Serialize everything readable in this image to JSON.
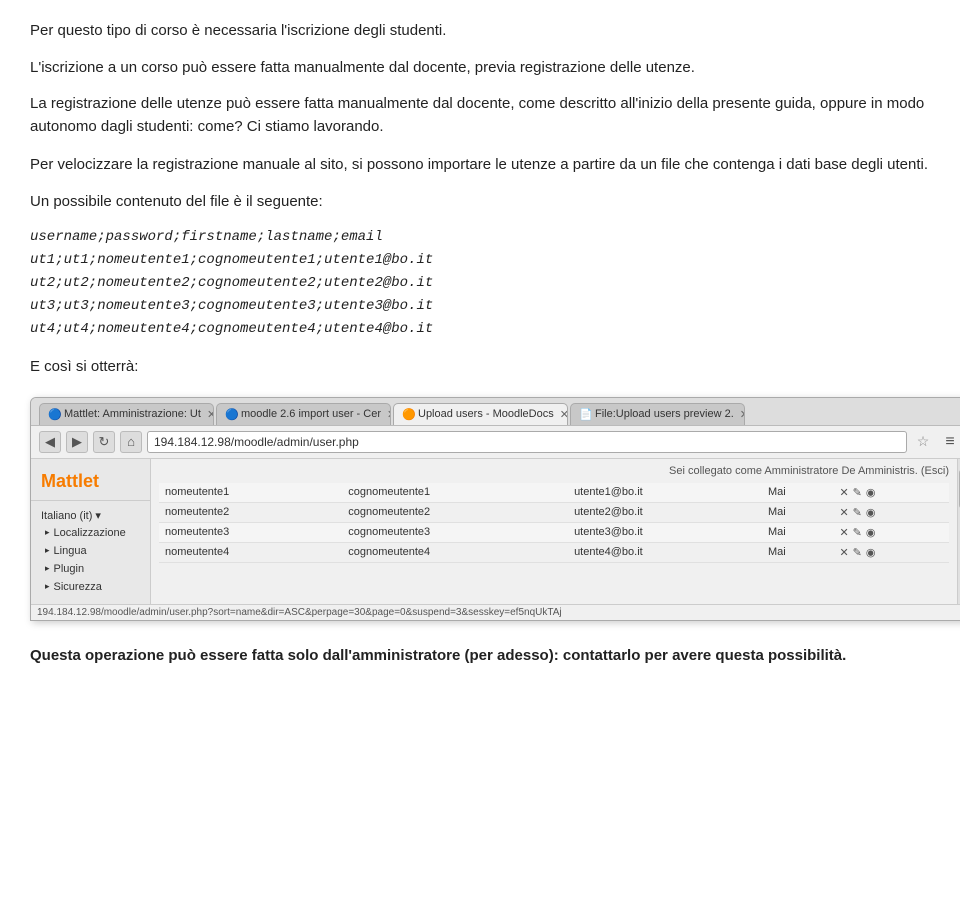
{
  "paragraphs": {
    "p1": "Per questo tipo di corso è necessaria l'iscrizione degli studenti.",
    "p2": "L'iscrizione a un corso può essere fatta manualmente dal docente, previa registrazione delle utenze.",
    "p3": "La registrazione delle utenze può essere fatta manualmente dal docente, come descritto all'inizio della presente guida, oppure in modo autonomo dagli studenti: come? Ci stiamo lavorando.",
    "p4": "Per velocizzare la registrazione manuale al sito, si possono importare le utenze a partire da un file che contenga i dati base degli utenti.",
    "p5": "Un possibile contenuto del file è il seguente:",
    "p6": "E così si otterrà:",
    "p7": "Questa operazione può essere fatta solo dall'amministratore (per adesso): contattarlo per avere questa possibilità."
  },
  "file_content": {
    "header": "username;password;firstname;lastname;email",
    "row1": "ut1;ut1;nomeutente1;cognomeutente1;utente1@bo.it",
    "row2": "ut2;ut2;nomeutente2;cognomeutente2;utente2@bo.it",
    "row3": "ut3;ut3;nomeutente3;cognomeutente3;utente3@bo.it",
    "row4": "ut4;ut4;nomeutente4;cognomeutente4;utente4@bo.it"
  },
  "browser": {
    "tabs": [
      {
        "label": "Mattlet: Amministrazione: Ut",
        "icon": "🔵",
        "active": false
      },
      {
        "label": "moodle 2.6 import user - Cer",
        "icon": "🔵",
        "active": false
      },
      {
        "label": "Upload users - MoodleDocs",
        "icon": "🟠",
        "active": true
      },
      {
        "label": "File:Upload users preview 2.",
        "icon": "📄",
        "active": false
      }
    ],
    "address": "194.184.12.98/moodle/admin/user.php",
    "admin_text": "Sei collegato come Amministratore De Amministris. (Esci)",
    "sidebar": {
      "logo": "Mattlet",
      "lang": "Italiano (it) ▾",
      "items": [
        "Localizzazione",
        "Lingua",
        "Plugin",
        "Sicurezza"
      ]
    },
    "table": {
      "rows": [
        {
          "name": "nomeutente1",
          "surname": "cognomeutente1",
          "email": "utente1@bo.it",
          "date": "Mai"
        },
        {
          "name": "nomeutente2",
          "surname": "cognomeutente2",
          "email": "utente2@bo.it",
          "date": "Mai"
        },
        {
          "name": "nomeutente3",
          "surname": "cognomeutente3",
          "email": "utente3@bo.it",
          "date": "Mai"
        },
        {
          "name": "nomeutente4",
          "surname": "cognomeutente4",
          "email": "utente4@bo.it",
          "date": "Mai"
        }
      ]
    },
    "status_bar": "194.184.12.98/moodle/admin/user.php?sort=name&dir=ASC&perpage=30&page=0&suspend=3&sesskey=ef5nqUkTAj"
  }
}
